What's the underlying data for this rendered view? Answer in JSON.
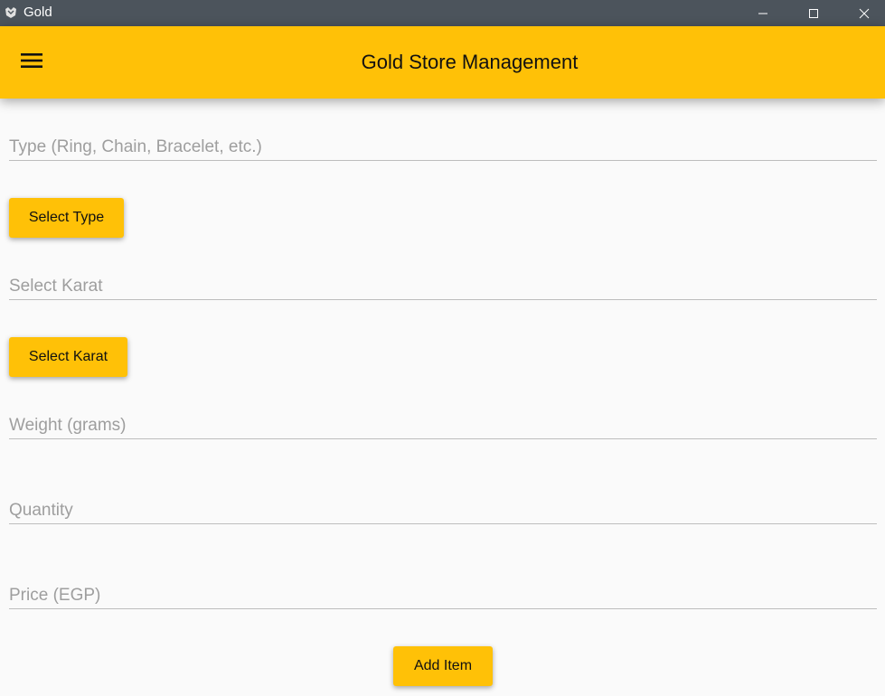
{
  "window": {
    "title": "Gold",
    "icon": "app-logo-icon",
    "controls": [
      "minimize-icon",
      "maximize-icon",
      "close-icon"
    ]
  },
  "appbar": {
    "menu_icon": "hamburger-menu-icon",
    "title": "Gold Store Management"
  },
  "form": {
    "type_placeholder": "Type (Ring, Chain, Bracelet, etc.)",
    "select_type_label": "Select Type",
    "karat_placeholder": "Select Karat",
    "select_karat_label": "Select Karat",
    "weight_placeholder": "Weight (grams)",
    "quantity_placeholder": "Quantity",
    "price_placeholder": "Price (EGP)",
    "add_item_label": "Add Item"
  },
  "colors": {
    "accent": "#ffc107",
    "titlebar": "#4c545c",
    "background": "#fafafa"
  }
}
